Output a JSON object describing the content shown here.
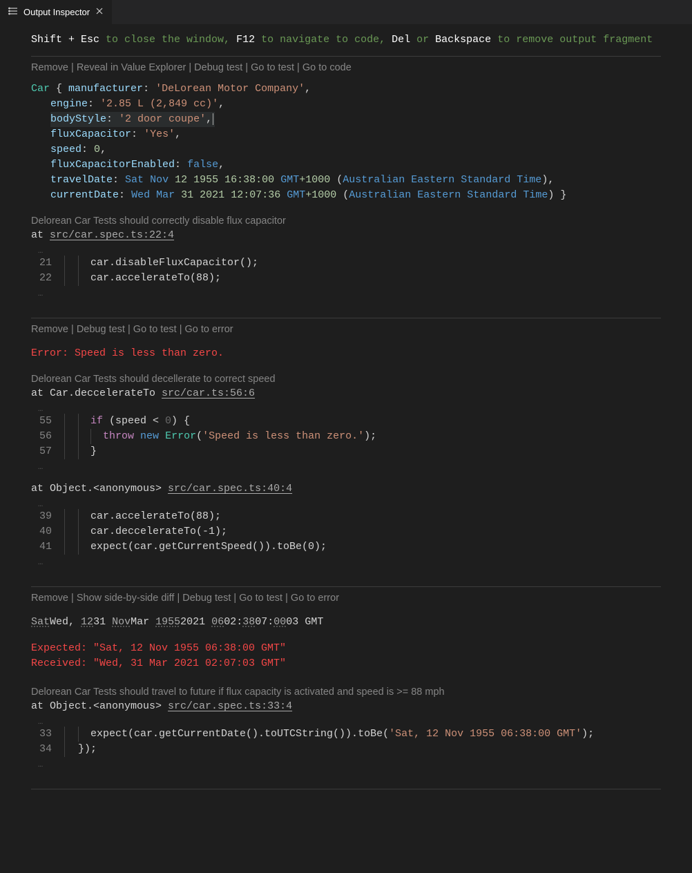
{
  "tab": {
    "title": "Output Inspector"
  },
  "hint": {
    "k1": "Shift + Esc",
    "t1": " to close the window, ",
    "k2": "F12",
    "t2": " to navigate to code, ",
    "k3": "Del",
    "t3": " or ",
    "k4": "Backspace",
    "t4": " to remove output fragment"
  },
  "section1": {
    "actions": [
      "Remove",
      "Reveal in Value Explorer",
      "Debug test",
      "Go to test",
      "Go to code"
    ],
    "obj_token_class": "Car",
    "obj": {
      "manufacturer": "'DeLorean Motor Company'",
      "engine": "'2.85 L (2,849 cc)'",
      "bodyStyle": "'2 door coupe'",
      "fluxCapacitor": "'Yes'",
      "speed": "0",
      "fluxCapacitorEnabled": "false",
      "travelDate": {
        "day": "Sat",
        "mon": "Nov",
        "dnum": "12",
        "year": "1955",
        "time": "16:38:00",
        "gmt": "GMT",
        "off": "+1000",
        "tz": "Australian Eastern Standard Time"
      },
      "currentDate": {
        "day": "Wed",
        "mon": "Mar",
        "dnum": "31",
        "year": "2021",
        "time": "12:07:36",
        "gmt": "GMT",
        "off": "+1000",
        "tz": "Australian Eastern Standard Time"
      }
    },
    "test_name": "Delorean Car Tests should correctly disable flux capacitor",
    "at_prefix": "at ",
    "at_link": "src/car.spec.ts:22:4",
    "lines": [
      {
        "n": "21",
        "dim": true,
        "code": "car.disableFluxCapacitor();"
      },
      {
        "n": "22",
        "dim": false,
        "code": "car.accelerateTo(88);"
      }
    ]
  },
  "section2": {
    "actions": [
      "Remove",
      "Debug test",
      "Go to test",
      "Go to error"
    ],
    "error_text": "Error: Speed is less than zero.",
    "test_name": "Delorean Car Tests should decellerate to correct speed",
    "frame1": {
      "prefix": "at Car.deccelerateTo ",
      "link": "src/car.ts:56:6"
    },
    "lines1": [
      {
        "n": "55",
        "dim": true,
        "raw": [
          {
            "t": "keyword",
            "v": "if"
          },
          {
            "t": "punct",
            "v": " (speed < "
          },
          {
            "t": "num",
            "v": "0"
          },
          {
            "t": "punct",
            "v": ") {"
          }
        ]
      },
      {
        "n": "56",
        "dim": false,
        "raw": [
          {
            "t": "keyword",
            "v": "throw"
          },
          {
            "t": "punct",
            "v": " "
          },
          {
            "t": "newkw",
            "v": "new"
          },
          {
            "t": "punct",
            "v": " "
          },
          {
            "t": "errclass",
            "v": "Error"
          },
          {
            "t": "punct",
            "v": "("
          },
          {
            "t": "strcode",
            "v": "'Speed is less than zero.'"
          },
          {
            "t": "punct",
            "v": ");"
          }
        ],
        "extraIndent": true
      },
      {
        "n": "57",
        "dim": true,
        "raw": [
          {
            "t": "punct",
            "v": "}"
          }
        ]
      }
    ],
    "frame2": {
      "prefix": "at Object.<anonymous> ",
      "link": "src/car.spec.ts:40:4"
    },
    "lines2": [
      {
        "n": "39",
        "dim": true,
        "code": "car.accelerateTo(88);"
      },
      {
        "n": "40",
        "dim": false,
        "code": "car.deccelerateTo(-1);"
      },
      {
        "n": "41",
        "dim": true,
        "code": "expect(car.getCurrentSpeed()).toBe(0);"
      }
    ]
  },
  "section3": {
    "actions": [
      "Remove",
      "Show side-by-side diff",
      "Debug test",
      "Go to test",
      "Go to error"
    ],
    "diff_parts": [
      {
        "u": true,
        "v": "Sat"
      },
      {
        "u": false,
        "v": "Wed"
      },
      {
        "u": false,
        "v": ", "
      },
      {
        "u": true,
        "v": "12"
      },
      {
        "u": false,
        "v": "31"
      },
      {
        "u": false,
        "v": " "
      },
      {
        "u": true,
        "v": "Nov"
      },
      {
        "u": false,
        "v": "Mar"
      },
      {
        "u": false,
        "v": " "
      },
      {
        "u": true,
        "v": "1955"
      },
      {
        "u": false,
        "v": "2021"
      },
      {
        "u": false,
        "v": " "
      },
      {
        "u": true,
        "v": "06"
      },
      {
        "u": false,
        "v": "02"
      },
      {
        "u": false,
        "v": ":"
      },
      {
        "u": true,
        "v": "38"
      },
      {
        "u": false,
        "v": "07"
      },
      {
        "u": false,
        "v": ":"
      },
      {
        "u": true,
        "v": "00"
      },
      {
        "u": false,
        "v": "03"
      },
      {
        "u": false,
        "v": " GMT"
      }
    ],
    "expected": "Expected: \"Sat, 12 Nov 1955 06:38:00 GMT\"",
    "received": "Received: \"Wed, 31 Mar 2021 02:07:03 GMT\"",
    "test_name": "Delorean Car Tests should travel to future if flux capacity is activated and speed is >= 88 mph",
    "frame": {
      "prefix": "at Object.<anonymous> ",
      "link": "src/car.spec.ts:33:4"
    },
    "lines": [
      {
        "n": "33",
        "dim": false,
        "raw": [
          {
            "t": "punct",
            "v": "expect(car.getCurrentDate().toUTCString()).toBe("
          },
          {
            "t": "strcode",
            "v": "'Sat, 12 Nov 1955 06:38:00 GMT'"
          },
          {
            "t": "punct",
            "v": ");"
          }
        ]
      },
      {
        "n": "34",
        "dim": true,
        "raw": [
          {
            "t": "punct",
            "v": "});"
          }
        ],
        "noBar2": true
      }
    ]
  }
}
